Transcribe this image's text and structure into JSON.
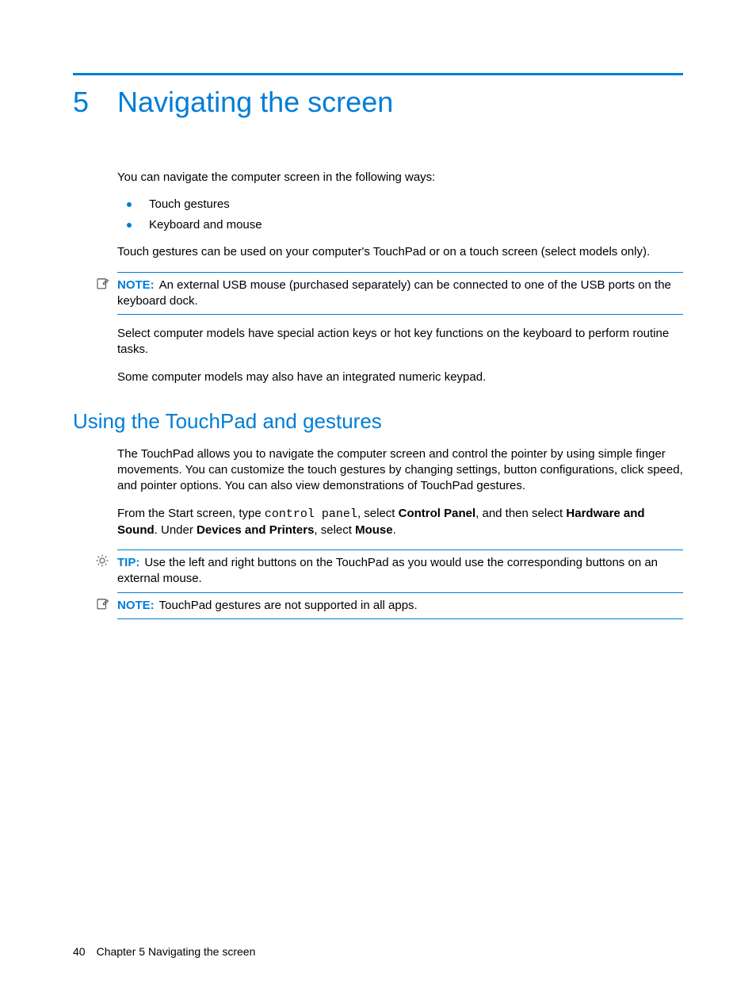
{
  "chapter": {
    "number": "5",
    "title": "Navigating the screen"
  },
  "intro": {
    "lead": "You can navigate the computer screen in the following ways:",
    "bullets": [
      "Touch gestures",
      "Keyboard and mouse"
    ],
    "after": "Touch gestures can be used on your computer's TouchPad or on a touch screen (select models only)."
  },
  "note1": {
    "label": "NOTE:",
    "text": "An external USB mouse (purchased separately) can be connected to one of the USB ports on the keyboard dock."
  },
  "para_actionkeys": "Select computer models have special action keys or hot key functions on the keyboard to perform routine tasks.",
  "para_keypad": "Some computer models may also have an integrated numeric keypad.",
  "section2": {
    "heading": "Using the TouchPad and gestures",
    "p1": "The TouchPad allows you to navigate the computer screen and control the pointer by using simple finger movements. You can customize the touch gestures by changing settings, button configurations, click speed, and pointer options. You can also view demonstrations of TouchPad gestures.",
    "p2_pre": "From the Start screen, type ",
    "p2_code": "control panel",
    "p2_mid1": ", select ",
    "p2_b1": "Control Panel",
    "p2_mid2": ", and then select ",
    "p2_b2": "Hardware and Sound",
    "p2_mid3": ". Under ",
    "p2_b3": "Devices and Printers",
    "p2_mid4": ", select ",
    "p2_b4": "Mouse",
    "p2_end": "."
  },
  "tip": {
    "label": "TIP:",
    "text": "Use the left and right buttons on the TouchPad as you would use the corresponding buttons on an external mouse."
  },
  "note2": {
    "label": "NOTE:",
    "text": "TouchPad gestures are not supported in all apps."
  },
  "footer": {
    "page": "40",
    "text": "Chapter 5   Navigating the screen"
  }
}
